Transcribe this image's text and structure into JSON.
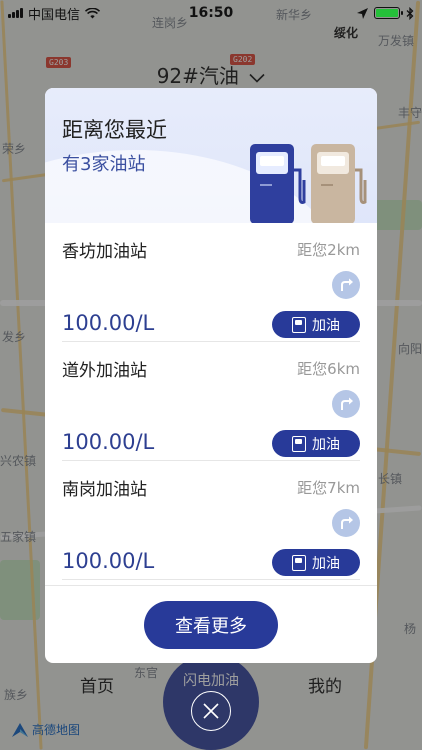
{
  "status_bar": {
    "carrier": "中国电信",
    "time": "16:50",
    "battery_color": "#25c03a"
  },
  "map": {
    "labels": [
      "连岗乡",
      "新华乡",
      "绥化",
      "万发镇",
      "丰守",
      "荣乡",
      "向阳",
      "发乡",
      "兴农镇",
      "长镇",
      "五家镇",
      "杨",
      "族乡",
      "东官"
    ],
    "brand": "高德地图"
  },
  "fuel_type": "92#汽油",
  "modal": {
    "title": "距离您最近",
    "subtitle": "有3家油站",
    "stations": [
      {
        "name": "香坊加油站",
        "distance": "距您2km",
        "price": "100.00/L",
        "button": "加油"
      },
      {
        "name": "道外加油站",
        "distance": "距您6km",
        "price": "100.00/L",
        "button": "加油"
      },
      {
        "name": "南岗加油站",
        "distance": "距您7km",
        "price": "100.00/L",
        "button": "加油"
      }
    ],
    "more_button": "查看更多"
  },
  "tabs": {
    "home": "首页",
    "center": "闪电加油",
    "mine": "我的"
  },
  "colors": {
    "primary": "#283a99",
    "price": "#2d3f91",
    "nav_button": "#b5c6e6",
    "header_bg": "#e7ecfb"
  },
  "icons": [
    "wifi-icon",
    "location-arrow-icon",
    "bluetooth-icon",
    "battery-icon",
    "chevron-down-icon",
    "fuel-pump-icon",
    "route-turn-icon",
    "refuel-icon",
    "close-icon"
  ]
}
